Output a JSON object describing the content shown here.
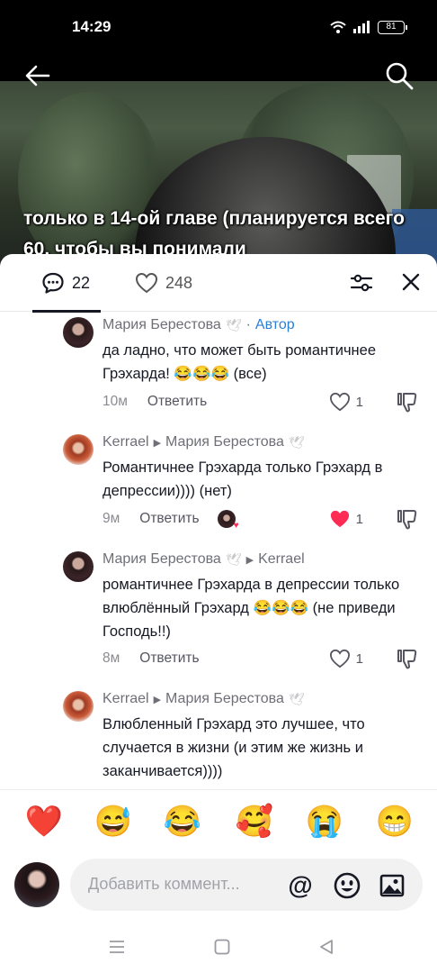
{
  "status_bar": {
    "time": "14:29",
    "battery": "81"
  },
  "video": {
    "caption": "только в 14-ой главе (планируется всего 60, чтобы вы понимали"
  },
  "sheet": {
    "comments_count": "22",
    "likes_count": "248"
  },
  "comments": [
    {
      "author": "Мария Берестова",
      "dot": "·",
      "badge": "Автор",
      "text": "да ладно, что может быть романтичнее Грэхарда! 😂😂😂 (все)",
      "time": "10м",
      "reply": "Ответить",
      "likes": "1",
      "liked": false
    },
    {
      "author": "Kerrael",
      "reply_to": "Мария Берестова",
      "text": "Романтичнее Грэхарда только Грэхард в депрессии)))) (нет)",
      "time": "9м",
      "reply": "Ответить",
      "likes": "1",
      "liked": true
    },
    {
      "author": "Мария Берестова",
      "reply_to": "Kerrael",
      "text": "романтичнее Грэхарда в депрессии только влюблённый Грэхард 😂😂😂 (не приведи Господь!!)",
      "time": "8м",
      "reply": "Ответить",
      "likes": "1",
      "liked": false
    },
    {
      "author": "Kerrael",
      "reply_to": "Мария Берестова",
      "text": "Влюбленный Грэхард это лучшее, что случается в жизни (и этим же жизнь и заканчивается))))"
    }
  ],
  "emojis": [
    "❤️",
    "😅",
    "😂",
    "🥰",
    "😭",
    "😁"
  ],
  "input": {
    "placeholder": "Добавить коммент...",
    "at": "@"
  },
  "colors": {
    "like_red": "#fe2c55",
    "author_blue": "#2a7fd6",
    "text": "#161823"
  }
}
